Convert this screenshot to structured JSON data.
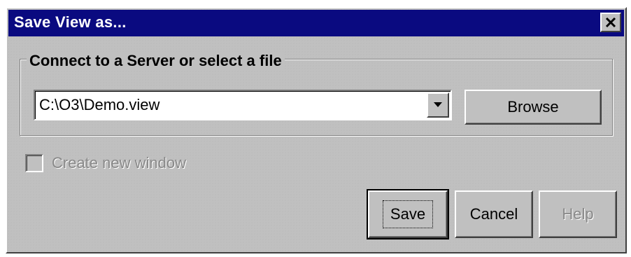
{
  "window": {
    "title": "Save View as...",
    "title_bar_color": "#0a0a80",
    "close_icon": "close-icon"
  },
  "group": {
    "label": "Connect to a Server or select a file"
  },
  "location": {
    "value": "C:\\O3\\Demo.view",
    "dropdown_icon": "chevron-down-icon"
  },
  "buttons": {
    "browse": "Browse",
    "save": "Save",
    "cancel": "Cancel",
    "help": "Help"
  },
  "options": {
    "create_new_window": {
      "label": "Create new window",
      "checked": false,
      "enabled": false
    }
  }
}
